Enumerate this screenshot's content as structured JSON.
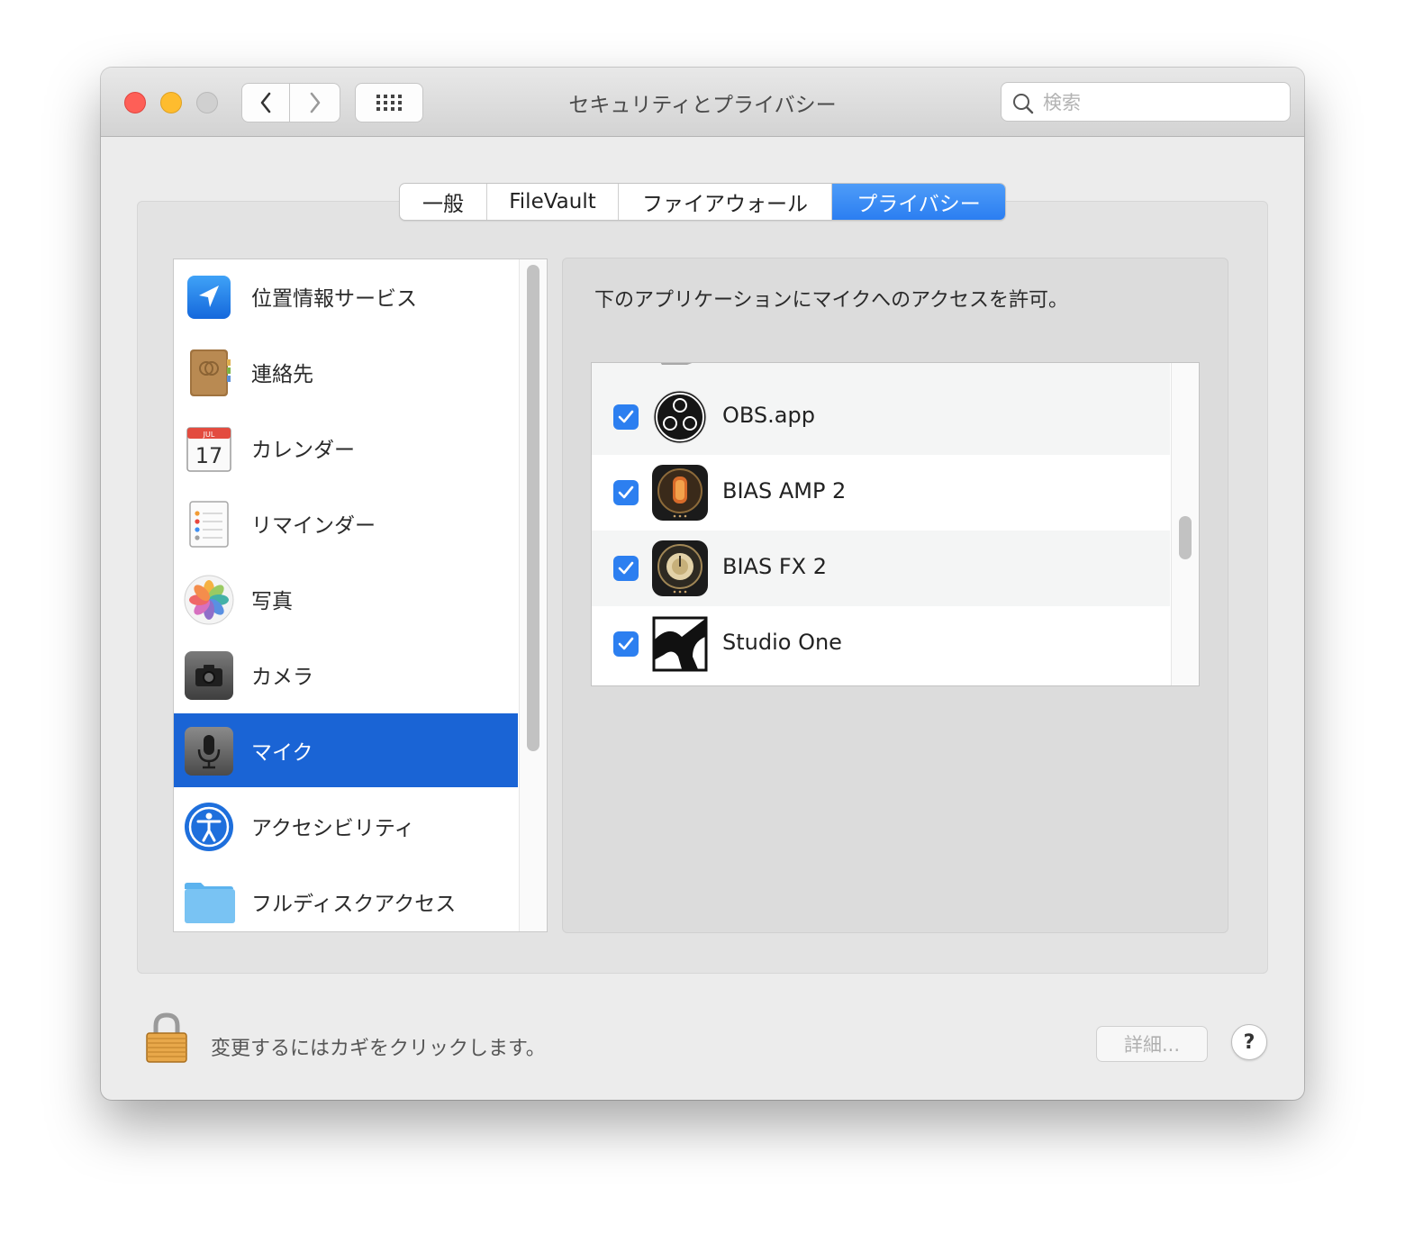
{
  "window": {
    "title": "セキュリティとプライバシー",
    "search_placeholder": "検索"
  },
  "tabs": [
    {
      "label": "一般",
      "active": false
    },
    {
      "label": "FileVault",
      "active": false
    },
    {
      "label": "ファイアウォール",
      "active": false
    },
    {
      "label": "プライバシー",
      "active": true
    }
  ],
  "sidebar": {
    "items": [
      {
        "label": "位置情報サービス",
        "icon": "location-arrow-icon"
      },
      {
        "label": "連絡先",
        "icon": "contacts-book-icon"
      },
      {
        "label": "カレンダー",
        "icon": "calendar-icon",
        "icon_month": "JUL",
        "icon_day": "17"
      },
      {
        "label": "リマインダー",
        "icon": "reminders-list-icon"
      },
      {
        "label": "写真",
        "icon": "photos-flower-icon"
      },
      {
        "label": "カメラ",
        "icon": "camera-icon"
      },
      {
        "label": "マイク",
        "icon": "microphone-icon",
        "selected": true
      },
      {
        "label": "アクセシビリティ",
        "icon": "accessibility-icon"
      },
      {
        "label": "フルディスクアクセス",
        "icon": "folder-icon"
      }
    ]
  },
  "panel": {
    "description": "下のアプリケーションにマイクへのアクセスを許可。",
    "apps": [
      {
        "name": "OBS.app",
        "checked": true,
        "icon": "obs-icon"
      },
      {
        "name": "BIAS AMP 2",
        "checked": true,
        "icon": "bias-amp-icon"
      },
      {
        "name": "BIAS FX 2",
        "checked": true,
        "icon": "bias-fx-icon"
      },
      {
        "name": "Studio One",
        "checked": true,
        "icon": "studio-one-icon"
      }
    ]
  },
  "footer": {
    "lock_text": "変更するにはカギをクリックします。",
    "details_label": "詳細...",
    "help_label": "?"
  },
  "colors": {
    "selection_blue": "#1a64d5",
    "tab_active_blue": "#2b7ef1",
    "checkbox_blue": "#2c7ff0"
  }
}
